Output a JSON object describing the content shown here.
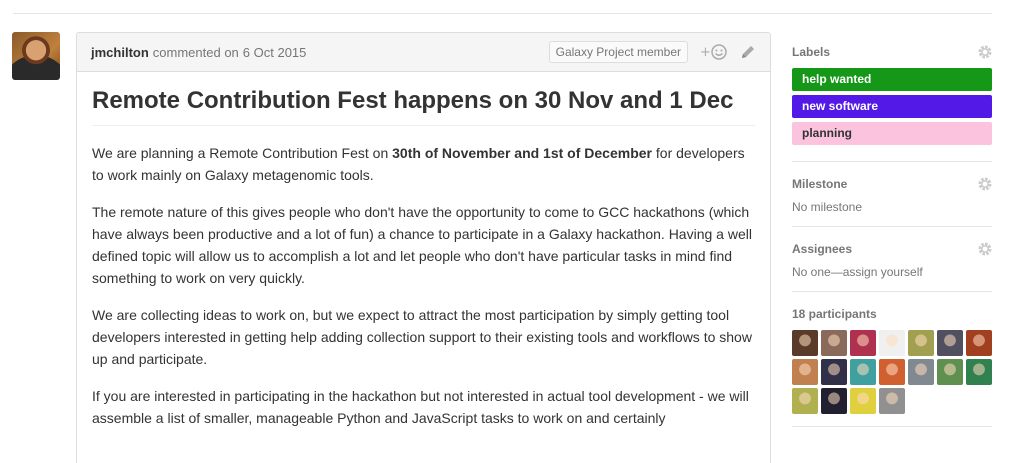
{
  "comment": {
    "author": "jmchilton",
    "action": "commented on",
    "date": "6 Oct 2015",
    "badge": "Galaxy Project member",
    "title": "Remote Contribution Fest happens on 30 Nov and 1 Dec",
    "p1_before": "We are planning a Remote Contribution Fest on ",
    "p1_bold": "30th of November and 1st of December",
    "p1_after": " for developers to work mainly on Galaxy metagenomic tools.",
    "p2": "The remote nature of this gives people who don't have the opportunity to come to GCC hackathons (which have always been productive and a lot of fun) a chance to participate in a Galaxy hackathon. Having a well defined topic will allow us to accomplish a lot and let people who don't have particular tasks in mind find something to work on very quickly.",
    "p3": "We are collecting ideas to work on, but we expect to attract the most participation by simply getting tool developers interested in getting help adding collection support to their existing tools and workflows to show up and participate.",
    "p4": "If you are interested in participating in the hackathon but not interested in actual tool development - we will assemble a list of smaller, manageable Python and JavaScript tasks to work on and certainly"
  },
  "sidebar": {
    "labels_heading": "Labels",
    "labels": [
      {
        "name": "help wanted",
        "bg": "#159818",
        "fg": "#ffffff"
      },
      {
        "name": "new software",
        "bg": "#5319e7",
        "fg": "#ffffff"
      },
      {
        "name": "planning",
        "bg": "#fbc3de",
        "fg": "#333333"
      }
    ],
    "milestone_heading": "Milestone",
    "milestone_value": "No milestone",
    "assignees_heading": "Assignees",
    "assignees_value": "No one—assign yourself",
    "participants_heading": "18 participants",
    "participant_colors": [
      "#5a3b2a",
      "#8a6a5a",
      "#b03050",
      "#f0f0f0",
      "#a0a050",
      "#505060",
      "#a04020",
      "#c08050",
      "#303048",
      "#40a0a0",
      "#d06030",
      "#808890",
      "#609050",
      "#308050",
      "#b0b050",
      "#202030",
      "#e0d040",
      "#909090"
    ]
  }
}
